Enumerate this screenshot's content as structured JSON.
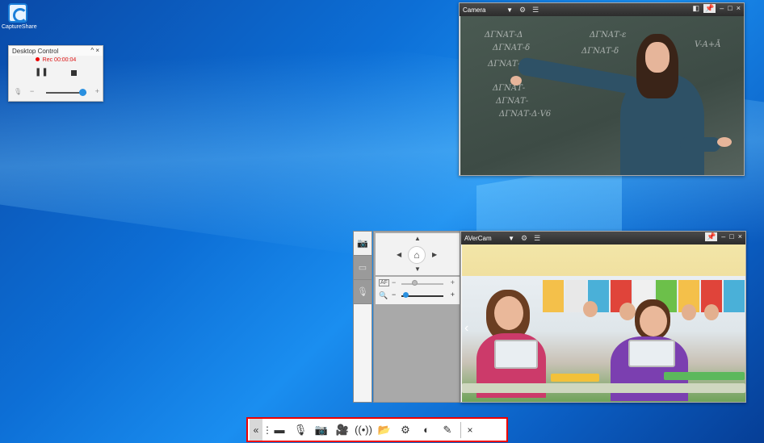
{
  "desktop": {
    "icon_label": "CaptureShare"
  },
  "desktop_control": {
    "title": "Desktop Control",
    "collapse_glyph": "^",
    "close_glyph": "×",
    "rec_label": "Rec",
    "rec_time": "00:00:04",
    "pause_glyph": "❚❚",
    "volume_minus": "−",
    "volume_plus": "+",
    "mic_glyph": "🎙",
    "volume_level": 0.9
  },
  "camera_window": {
    "source": "Camera",
    "dropdown_glyph": "▼",
    "settings_glyph": "⚙",
    "menu_glyph": "☰",
    "layout_glyph": "◧",
    "pin_glyph": "📌",
    "min_glyph": "–",
    "max_glyph": "□",
    "close_glyph": "×"
  },
  "avercam_window": {
    "source": "AVerCam",
    "dropdown_glyph": "▼",
    "settings_glyph": "⚙",
    "menu_glyph": "☰",
    "pin_glyph": "📌",
    "min_glyph": "–",
    "max_glyph": "□",
    "close_glyph": "×",
    "nav_left": "‹"
  },
  "ptz_panel": {
    "tabs": [
      "📷",
      "▭",
      "🎙"
    ],
    "up": "▲",
    "down": "▼",
    "left": "◀",
    "right": "▶",
    "home_glyph": "⌂",
    "focus_icon": "AF",
    "zoom_icon": "🔍",
    "minus": "−",
    "plus": "+",
    "focus_level": 0.3,
    "zoom_level": 0.1
  },
  "toolbar": {
    "collapse_glyph": "«",
    "grip_glyph": "⋮",
    "items": [
      "▬",
      "🎙",
      "📷",
      "🎥",
      "((•))",
      "📂",
      "⚙",
      "◐",
      "✎"
    ],
    "close_glyph": "×",
    "highlight_color": "#ee0000"
  }
}
